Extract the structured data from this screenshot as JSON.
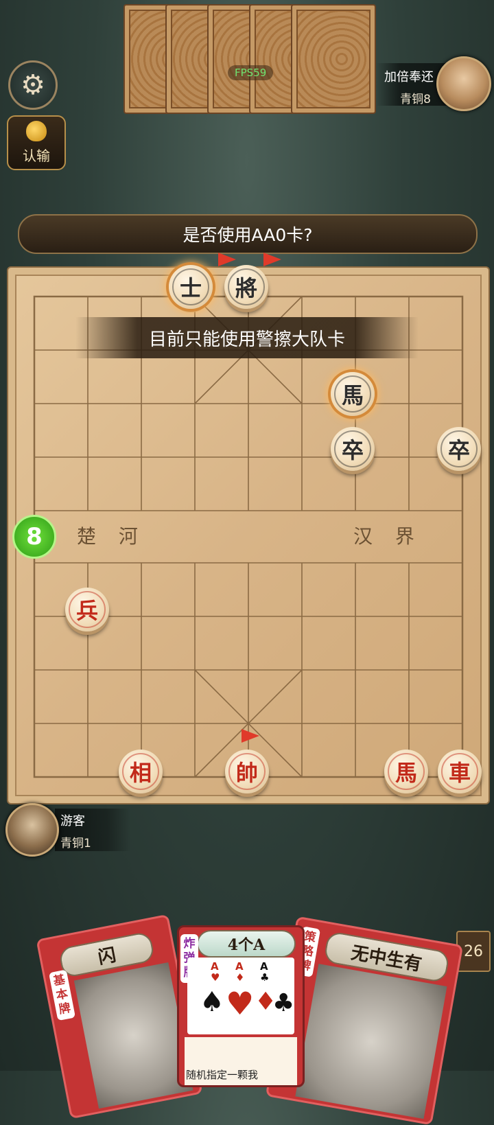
{
  "hud": {
    "fps": "FPS59",
    "surrender_label": "认输",
    "prompt": "是否使用AA0卡?",
    "toast": "目前只能使用警擦大队卡",
    "turn_timer": "8",
    "deck_count": "26"
  },
  "opponent": {
    "name": "加倍奉还",
    "rank": "青铜8",
    "hand_cards": 5
  },
  "player": {
    "name": "游客",
    "rank": "青铜1"
  },
  "board": {
    "river_left": "楚 河",
    "river_right": "汉 界",
    "pieces": [
      {
        "char": "士",
        "side": "black",
        "chained": true
      },
      {
        "char": "將",
        "side": "black",
        "chained": false
      },
      {
        "char": "馬",
        "side": "black",
        "chained": true
      },
      {
        "char": "卒",
        "side": "black",
        "chained": false
      },
      {
        "char": "卒",
        "side": "black",
        "chained": false
      },
      {
        "char": "兵",
        "side": "red",
        "chained": false
      },
      {
        "char": "相",
        "side": "red",
        "chained": false
      },
      {
        "char": "帥",
        "side": "red",
        "chained": false
      },
      {
        "char": "馬",
        "side": "red",
        "chained": false
      },
      {
        "char": "車",
        "side": "red",
        "chained": false
      }
    ]
  },
  "hand": [
    {
      "title": "闪",
      "type": "基本牌"
    },
    {
      "title": "4个A",
      "type": "炸弹牌",
      "ranks": [
        "A",
        "A",
        "A"
      ],
      "desc": "随机指定一颗我"
    },
    {
      "title": "无中生有",
      "type": "策略牌"
    }
  ],
  "colors": {
    "red_piece": "#c22a1a",
    "black_piece": "#2c2c2c",
    "timer_green": "#2f9d18",
    "card_red": "#c43434"
  }
}
